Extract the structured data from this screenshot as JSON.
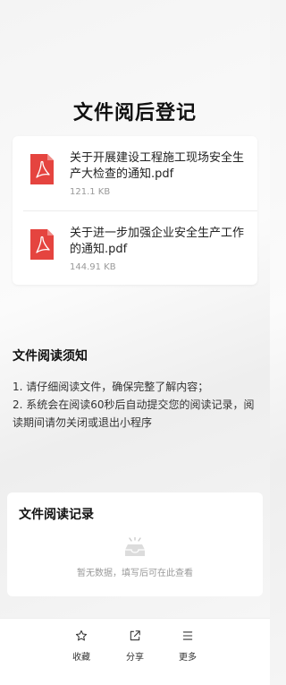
{
  "page": {
    "title": "文件阅后登记"
  },
  "files": [
    {
      "name": "关于开展建设工程施工现场安全生产大检查的通知.pdf",
      "size": "121.1 KB",
      "icon": "pdf-icon"
    },
    {
      "name": "关于进一步加强企业安全生产工作的通知.pdf",
      "size": "144.91 KB",
      "icon": "pdf-icon"
    }
  ],
  "notice": {
    "title": "文件阅读须知",
    "lines": [
      "1. 请仔细阅读文件，确保完整了解内容；",
      "2. 系统会在阅读60秒后自动提交您的阅读记录，阅读期间请勿关闭或退出小程序"
    ]
  },
  "records": {
    "title": "文件阅读记录",
    "empty_text": "暂无数据，填写后可在此查看",
    "empty_icon": "inbox-icon"
  },
  "bottom_bar": {
    "items": [
      {
        "label": "收藏",
        "icon": "star-icon"
      },
      {
        "label": "分享",
        "icon": "share-icon"
      },
      {
        "label": "更多",
        "icon": "menu-icon"
      }
    ]
  },
  "colors": {
    "pdf_red": "#e5443f",
    "text_muted": "#999999"
  }
}
